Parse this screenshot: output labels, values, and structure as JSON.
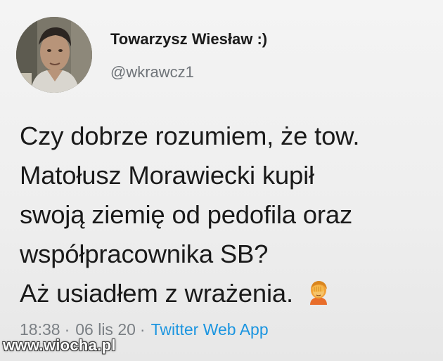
{
  "user": {
    "display_name": "Towarzysz Wiesław :)",
    "handle": "@wkrawcz1"
  },
  "tweet": {
    "lines": [
      "Czy dobrze rozumiem, że tow.",
      "Matołusz Morawiecki kupił",
      "swoją ziemię od pedofila oraz",
      "współpracownika SB?",
      "Aż usiadłem z wrażenia."
    ],
    "emoji": "facepalm-woman-emoji"
  },
  "meta": {
    "time": "18:38",
    "date": "06 lis 20",
    "separator": "·",
    "app": "Twitter Web App"
  },
  "watermark": "www.wiocha.pl",
  "colors": {
    "background": "#eeeeee",
    "text": "#1a1a1a",
    "muted": "#6f7479",
    "link": "#1b95e0"
  }
}
